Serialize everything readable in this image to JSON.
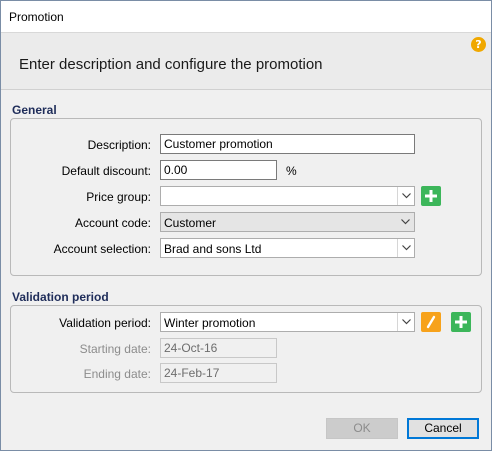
{
  "window": {
    "title": "Promotion"
  },
  "header": {
    "text": "Enter description and configure the promotion",
    "help_icon": "?"
  },
  "general": {
    "title": "General",
    "description": {
      "label": "Description:",
      "value": "Customer promotion"
    },
    "default_discount": {
      "label": "Default discount:",
      "value": "0.00",
      "unit": "%"
    },
    "price_group": {
      "label": "Price group:",
      "value": ""
    },
    "account_code": {
      "label": "Account code:",
      "value": "Customer"
    },
    "account_selection": {
      "label": "Account selection:",
      "value": "Brad and sons Ltd"
    }
  },
  "validation": {
    "title": "Validation period",
    "period": {
      "label": "Validation period:",
      "value": "Winter promotion"
    },
    "starting_date": {
      "label": "Starting date:",
      "value": "24-Oct-16"
    },
    "ending_date": {
      "label": "Ending date:",
      "value": "24-Feb-17"
    }
  },
  "footer": {
    "ok_label": "OK",
    "cancel_label": "Cancel"
  },
  "colors": {
    "accent": "#0078d7",
    "add": "#3cb65a",
    "edit": "#f7a21b",
    "help": "#f0a800"
  },
  "icons": {
    "add": "plus-icon",
    "edit": "pencil-icon",
    "dropdown": "chevron-down-icon",
    "help": "help-icon"
  }
}
